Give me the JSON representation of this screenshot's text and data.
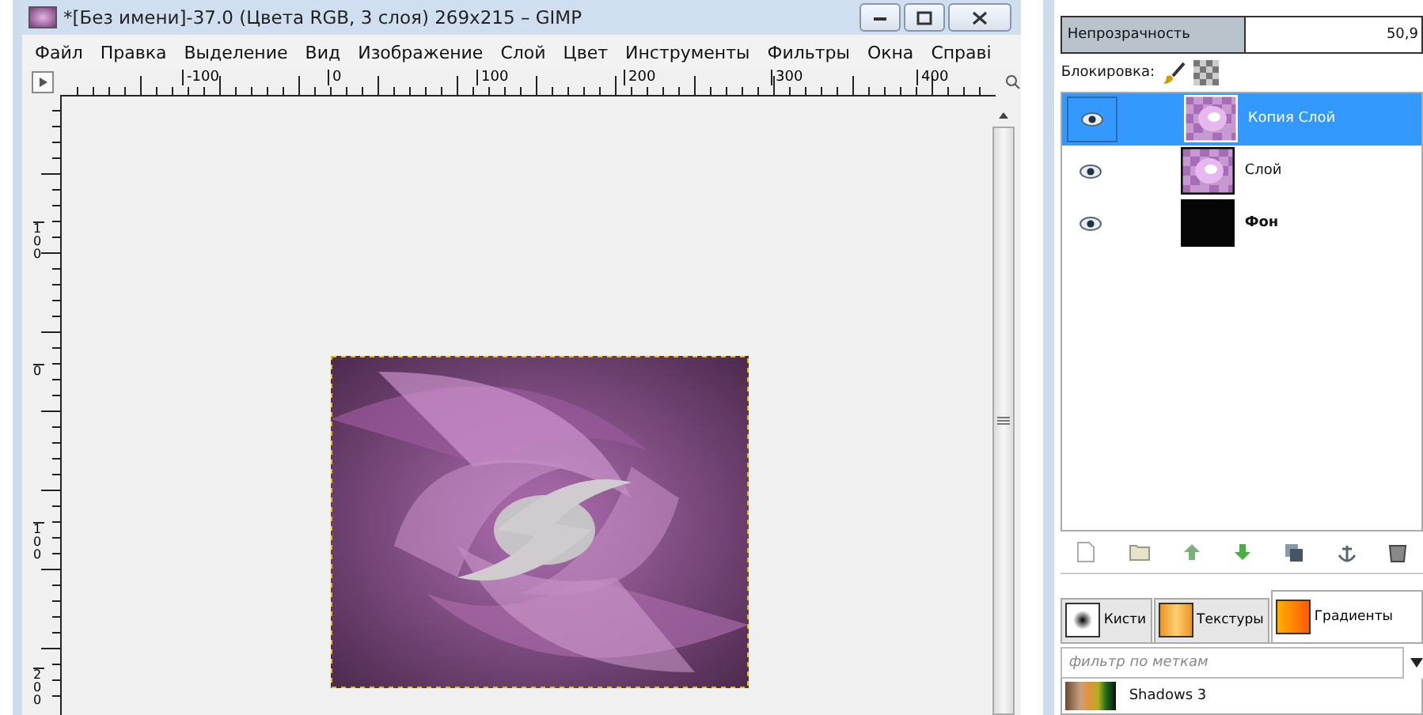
{
  "window": {
    "title": "*[Без имени]-37.0 (Цвета RGB, 3 слоя) 269x215 – GIMP"
  },
  "menu": [
    "Файл",
    "Правка",
    "Выделение",
    "Вид",
    "Изображение",
    "Слой",
    "Цвет",
    "Инструменты",
    "Фильтры",
    "Окна",
    "Справі"
  ],
  "hruler": [
    "-100",
    "0",
    "100",
    "200",
    "300",
    "400"
  ],
  "vruler": [
    "100",
    "0",
    "100",
    "200"
  ],
  "layers_panel": {
    "opacity_label": "Непрозрачность",
    "opacity_value": "50,9",
    "lock_label": "Блокировка:",
    "layers": [
      {
        "name": "Копия Слой",
        "selected": true,
        "visible": true,
        "kind": "swirl"
      },
      {
        "name": "Слой",
        "selected": false,
        "visible": true,
        "kind": "swirl"
      },
      {
        "name": "Фон",
        "selected": false,
        "visible": true,
        "kind": "background"
      }
    ]
  },
  "tabs": [
    {
      "label": "Кисти",
      "selected": false,
      "kind": "brush"
    },
    {
      "label": "Текстуры",
      "selected": false,
      "kind": "pattern"
    },
    {
      "label": "Градиенты",
      "selected": true,
      "kind": "gradient"
    }
  ],
  "filter": {
    "placeholder": "фильтр по меткам"
  },
  "gradients": [
    {
      "name": "Shadows 3"
    }
  ]
}
